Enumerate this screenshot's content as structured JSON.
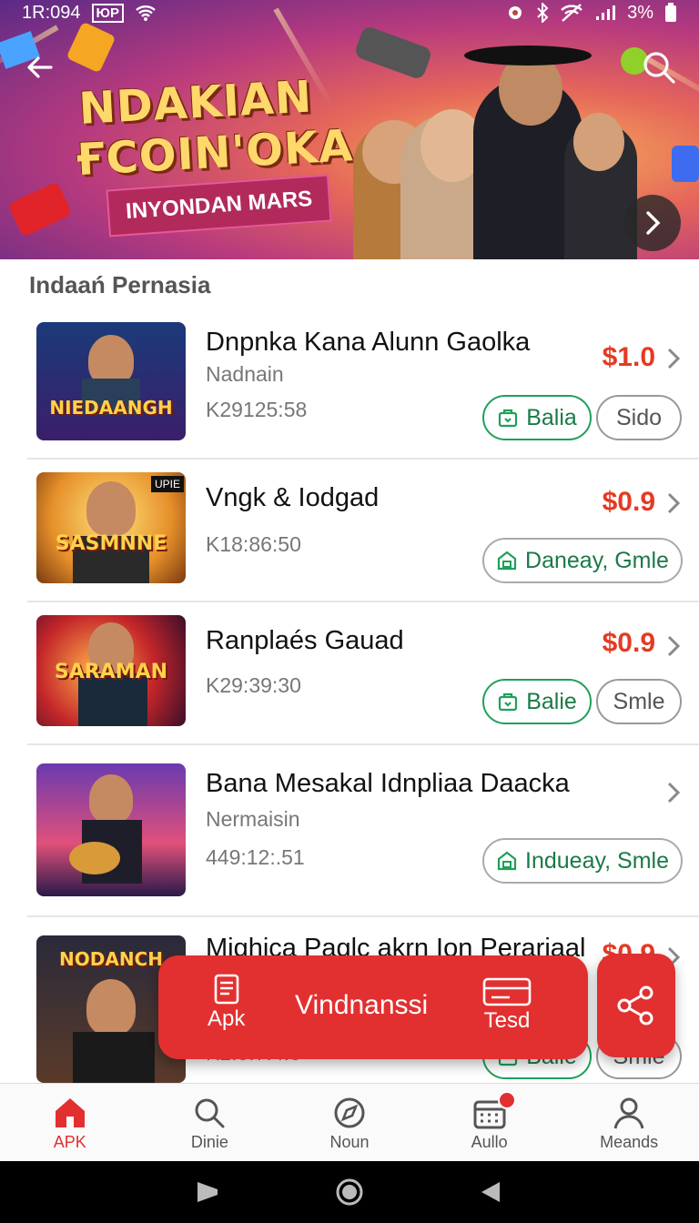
{
  "status_bar": {
    "time": "1R:094",
    "app_badge": "ЮР",
    "battery": "3%"
  },
  "banner": {
    "title_line1": "NDAKIAN",
    "title_line2": "ҒCOIN'OKA",
    "subtitle": "INYONDAN MARS"
  },
  "section": {
    "title": "Indaań Pernasia"
  },
  "items": [
    {
      "title": "Dnpnka Kana Alunn Gaolka",
      "sub": "Nadnain",
      "code": "K29125:58",
      "price": "$1.0",
      "thumb_text": "NIEDAANGH",
      "pill1": "Balia",
      "pill2": "Sido"
    },
    {
      "title": "Vngk & Iodgad",
      "sub": "",
      "code": "K18:86:50",
      "price": "$0.9",
      "thumb_text": "SASMNNE",
      "thumb_corner": "UPIE",
      "pill1": "Daneay, Gmle"
    },
    {
      "title": "Ranplaés Gauad",
      "sub": "",
      "code": "K29:39:30",
      "price": "$0.9",
      "thumb_text": "SARAMAN",
      "pill1": "Balie",
      "pill2": "Smle"
    },
    {
      "title": "Bana Mesakal Idnpliaa Daacka",
      "sub": "Nermaisin",
      "code": "449:12:.51",
      "price": "",
      "thumb_text": "",
      "pill1": "Indueay, Smle"
    },
    {
      "title": "Mighica Paglc akrn Ion Perarjaal",
      "sub": "",
      "code": "K2:0:7:4:5",
      "price": "$0.9",
      "thumb_text": "NODANCH",
      "pill1": "Balie",
      "pill2": "Smle"
    }
  ],
  "fab": {
    "apk_label": "Apk",
    "main_label": "Vindnanssi",
    "tesd_label": "Tesd"
  },
  "bottom_nav": [
    {
      "label": "APK",
      "icon": "home-icon"
    },
    {
      "label": "Dinie",
      "icon": "search-icon"
    },
    {
      "label": "Noun",
      "icon": "compass-icon"
    },
    {
      "label": "Aullo",
      "icon": "calendar-icon"
    },
    {
      "label": "Meands",
      "icon": "person-icon"
    }
  ],
  "colors": {
    "accent": "#e23030",
    "price": "#e43b23",
    "green": "#1fa05a"
  }
}
